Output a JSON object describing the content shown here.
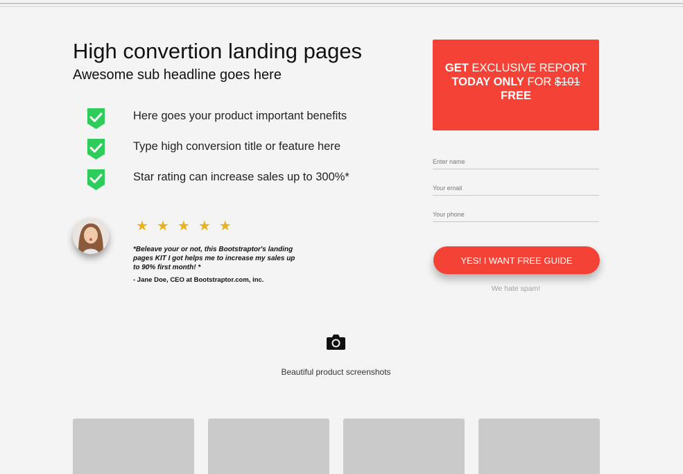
{
  "hero": {
    "headline": "High convertion landing pages",
    "subheadline": "Awesome sub headline goes here"
  },
  "benefits": [
    {
      "text": "Here goes your product important benefits",
      "icon": "shield-check-icon"
    },
    {
      "text": "Type high conversion title or feature here",
      "icon": "shield-check-icon"
    },
    {
      "text": "Star rating can increase sales up to 300%*",
      "icon": "shield-check-icon"
    }
  ],
  "testimonial": {
    "rating": 5,
    "stars": [
      "★",
      "★",
      "★",
      "★",
      "★"
    ],
    "quote": "*Beleave your or not, this Bootstraptor's landing pages KIT I got helps me to increase my sales up to 90% first month! *",
    "author": "- Jane Doe, CEO at Bootstraptor.com, inc."
  },
  "offer": {
    "get": "GET",
    "exclusive": " EXCLUSIVE REPORT",
    "today_only": "TODAY ONLY",
    "for": " FOR ",
    "old_price": "$101",
    "free": "FREE"
  },
  "form": {
    "name_placeholder": "Enter name",
    "email_placeholder": "Your email",
    "phone_placeholder": "Your phone",
    "submit_label": "YES! I WANT FREE GUIDE",
    "spam_note": "We hate spam!"
  },
  "screenshots": {
    "icon": "camera-icon",
    "caption": "Beautiful product screenshots",
    "thumbnail_count": 4
  },
  "colors": {
    "accent": "#f44336",
    "check": "#2ecc5a",
    "star": "#e8b21b",
    "background": "#f4f4f4",
    "thumbnail": "#cacaca"
  }
}
